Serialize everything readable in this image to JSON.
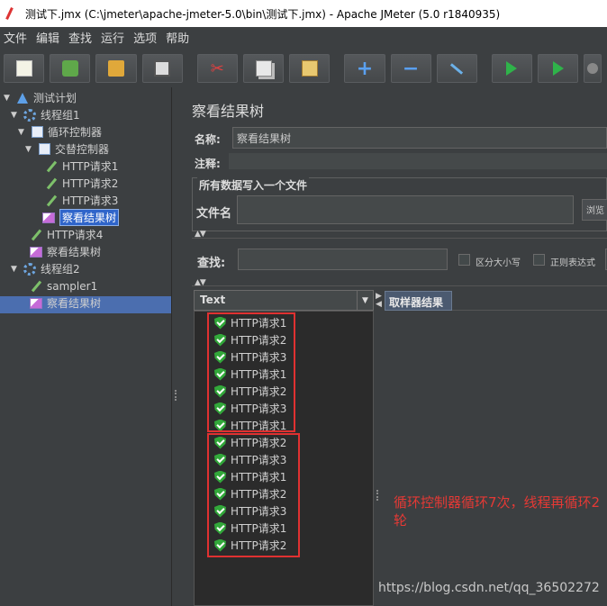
{
  "window": {
    "title": "测试下.jmx (C:\\jmeter\\apache-jmeter-5.0\\bin\\测试下.jmx) - Apache JMeter (5.0 r1840935)"
  },
  "menu": [
    "文件",
    "编辑",
    "查找",
    "运行",
    "选项",
    "帮助"
  ],
  "toolbar": {
    "icons": [
      "new-icon",
      "templates-icon",
      "open-icon",
      "save-icon",
      "cut-icon",
      "copy-icon",
      "paste-icon",
      "expand-icon",
      "collapse-icon",
      "toggle-icon",
      "start-icon",
      "start-no-pause-icon",
      "stop-icon"
    ],
    "expand": "+",
    "collapse": "−"
  },
  "tree": {
    "test_plan": "测试计划",
    "thread_group_1": "线程组1",
    "loop_controller": "循环控制器",
    "interleave_controller": "交替控制器",
    "http1": "HTTP请求1",
    "http2": "HTTP请求2",
    "http3": "HTTP请求3",
    "view_tree_sel": "察看结果树",
    "http4": "HTTP请求4",
    "view_tree_2": "察看结果树",
    "thread_group_2": "线程组2",
    "sampler1": "sampler1",
    "view_tree_3": "察看结果树"
  },
  "panel": {
    "title": "察看结果树",
    "name_label": "名称:",
    "name_value": "察看结果树",
    "comment_label": "注释:",
    "file_group_title": "所有数据写入一个文件",
    "filename_label": "文件名",
    "browse_label": "浏览",
    "search_label": "查找:",
    "case_sensitive": "区分大小写",
    "regex": "正则表达式",
    "renderer_value": "Text",
    "results_tab": "取样器结果"
  },
  "results": [
    "HTTP请求1",
    "HTTP请求2",
    "HTTP请求3",
    "HTTP请求1",
    "HTTP请求2",
    "HTTP请求3",
    "HTTP请求1",
    "HTTP请求2",
    "HTTP请求3",
    "HTTP请求1",
    "HTTP请求2",
    "HTTP请求3",
    "HTTP请求1",
    "HTTP请求2"
  ],
  "annotation": "循环控制器循环7次，线程再循环2轮",
  "watermark": "https://blog.csdn.net/qq_36502272",
  "colors": {
    "accent": "#4b6eaf",
    "annotation_red": "#e53935",
    "success_green": "#32a83a"
  }
}
